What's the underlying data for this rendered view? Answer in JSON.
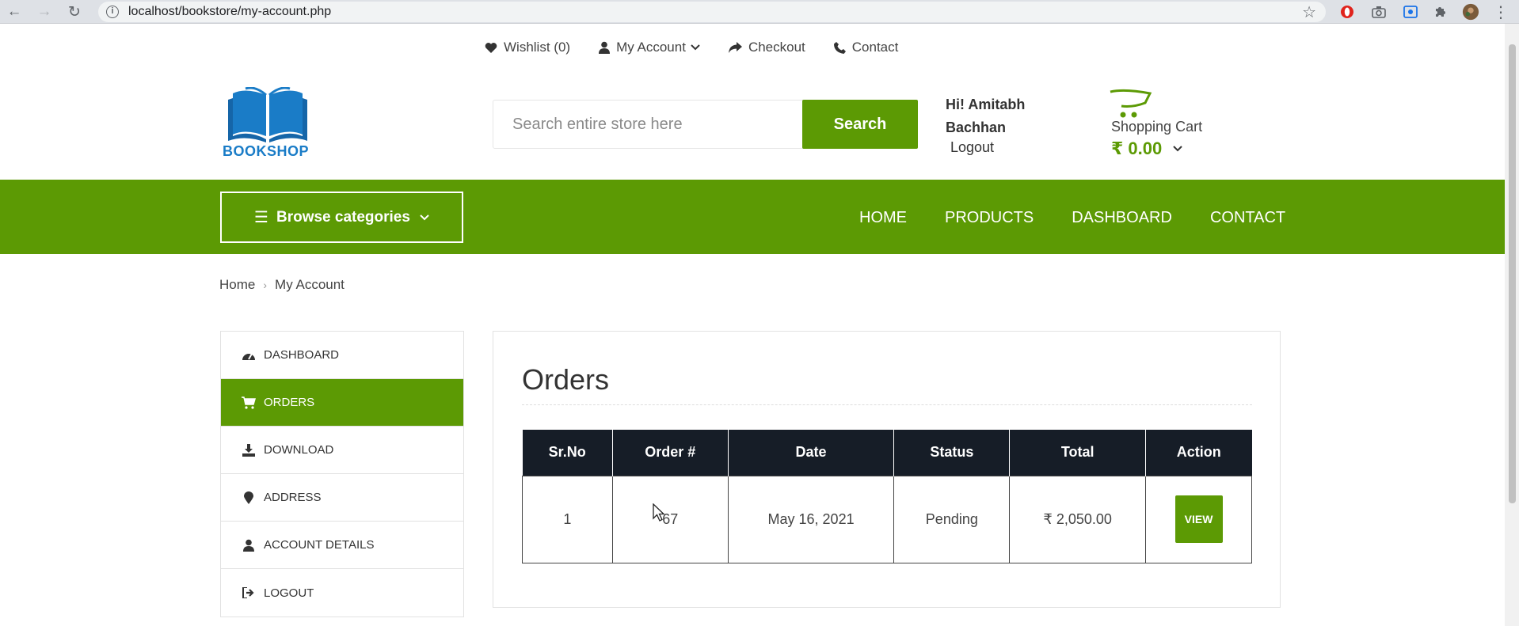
{
  "browser": {
    "url": "localhost/bookstore/my-account.php"
  },
  "toplinks": {
    "wishlist": "Wishlist (0)",
    "account": "My Account",
    "checkout": "Checkout",
    "contact": "Contact"
  },
  "logo": {
    "text": "BOOKSHOP",
    "color": "#1a7cc7"
  },
  "search": {
    "placeholder": "Search entire store here",
    "button": "Search"
  },
  "user": {
    "greeting": "Hi! Amitabh Bachhan",
    "logout": "Logout"
  },
  "cart": {
    "label": "Shopping Cart",
    "total": "₹ 0.00"
  },
  "navbar": {
    "browse": "Browse categories",
    "items": [
      "HOME",
      "PRODUCTS",
      "DASHBOARD",
      "CONTACT"
    ],
    "color": "#5c9a04"
  },
  "breadcrumb": {
    "home": "Home",
    "current": "My Account"
  },
  "sidebar": {
    "items": [
      {
        "label": "DASHBOARD",
        "icon": "dashboard-icon"
      },
      {
        "label": "ORDERS",
        "icon": "cart-icon",
        "active": true
      },
      {
        "label": "DOWNLOAD",
        "icon": "download-icon"
      },
      {
        "label": "ADDRESS",
        "icon": "map-marker-icon"
      },
      {
        "label": "ACCOUNT DETAILS",
        "icon": "user-icon"
      },
      {
        "label": "LOGOUT",
        "icon": "sign-out-icon"
      }
    ]
  },
  "orders": {
    "title": "Orders",
    "columns": [
      "Sr.No",
      "Order #",
      "Date",
      "Status",
      "Total",
      "Action"
    ],
    "rows": [
      {
        "srno": "1",
        "order": "67",
        "date": "May 16, 2021",
        "status": "Pending",
        "total": "₹ 2,050.00",
        "action": "VIEW"
      }
    ]
  }
}
